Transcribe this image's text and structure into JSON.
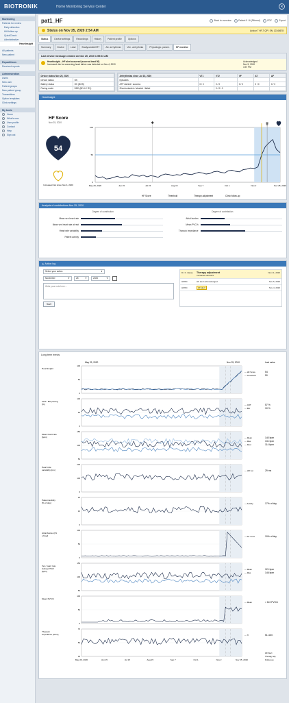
{
  "app": {
    "brand": "BIOTRONIK",
    "title": "Home Monitoring Service Center"
  },
  "sidebar": {
    "sections": [
      {
        "title": "Monitoring",
        "items": [
          {
            "label": "Patients for review",
            "sub": false
          },
          {
            "label": "Early detection",
            "sub": true
          },
          {
            "label": "HM follow-up",
            "sub": true
          },
          {
            "label": "QuickCheck",
            "sub": true
          },
          {
            "label": "Administrative",
            "sub": true
          },
          {
            "label": "Heartinsight",
            "sub": false,
            "active": true
          }
        ]
      },
      {
        "title": "",
        "items": [
          {
            "label": "All patients",
            "sub": false
          },
          {
            "label": "New patient",
            "sub": false
          }
        ]
      },
      {
        "title": "Repartitions",
        "items": [
          {
            "label": "Received reports",
            "sub": false
          }
        ]
      },
      {
        "title": "Administration",
        "items": [
          {
            "label": "Users",
            "sub": false
          },
          {
            "label": "New user",
            "sub": false
          },
          {
            "label": "Patient groups",
            "sub": false
          },
          {
            "label": "New patient group",
            "sub": false
          },
          {
            "label": "Transmitters",
            "sub": false
          },
          {
            "label": "Option templates",
            "sub": false
          },
          {
            "label": "Clinic settings",
            "sub": false
          }
        ]
      }
    ],
    "tools_title": "My tools",
    "tools": [
      "Home",
      "What's new",
      "User profile",
      "Contact",
      "Help",
      "Sign out"
    ]
  },
  "patient": {
    "name": "pat1_HF"
  },
  "header_actions": [
    "Back to overview",
    "Patient 5 / 6 (Filtered)",
    "PDF",
    "Export"
  ],
  "status": {
    "text": "Status on Nov 25, 2020 2:54 AM",
    "device": "Acticor 7 HF-T QP / SN: 12345678"
  },
  "tabs_main": [
    "Status",
    "Device settings",
    "Recordings",
    "History",
    "Patient profile",
    "Options"
  ],
  "tabs_sub": [
    "Summary",
    "Device",
    "Lead",
    "Bradycardia/CRT",
    "Atr. arrhythmia",
    "Ven. arrhythmia",
    "Physiologic. param.",
    "HF monitor"
  ],
  "last_message": {
    "title": "Last device message created on Nov 25, 2020 1:55:03 AM",
    "line1": "HeartInsight – HF alert occurred (score at least 50)",
    "line2": "Increased risk for worsening heart failure was detected on Nov 4, 2020",
    "ack": "Acknowledged",
    "ack_date": "Nov 5, 2020",
    "ack_time": "3:37 PM"
  },
  "device_status": {
    "title": "Device status Nov 25, 2020",
    "rows": [
      {
        "label": "Device status",
        "value": "OK"
      },
      {
        "label": "Battery status",
        "value": "OK (BOS)"
      },
      {
        "label": "Pacing mode",
        "value": "DDD (BiV LV RV)"
      }
    ]
  },
  "arrhythmia": {
    "title": "Arrhythmias since Jul 15, 2020",
    "cols": [
      "VT1",
      "VT2",
      "VF",
      "AT",
      "AF"
    ],
    "rows": [
      {
        "label": "Episodes",
        "values": [
          "",
          "",
          "",
          "",
          ""
        ]
      },
      {
        "label": "ATP started / success",
        "values": [
          "0 / 0",
          "0 / 0",
          "0 / 0",
          "0 / 0",
          "0 / 0"
        ]
      },
      {
        "label": "Shocks started / aborted / failed",
        "values": [
          "",
          "0 / 0 / 0",
          "",
          "",
          ""
        ]
      }
    ]
  },
  "heartinsight": {
    "title": "HeartInsight",
    "score_title": "HF Score",
    "score_date": "Nov 25, 2020",
    "score": "54",
    "risk_text": "Increased risk since Nov 4, 2020",
    "chart_data": {
      "type": "line",
      "x_labels": [
        "May 29, 2020",
        "Jun 15",
        "Jul 15",
        "Aug 15",
        "Sep 7",
        "Oct 1",
        "Nov 2",
        "Nov 25, 2020"
      ],
      "y_ticks": [
        100,
        50,
        0
      ],
      "threshold": 50,
      "series": [
        {
          "name": "HF Score",
          "values": [
            12,
            8,
            10,
            6,
            7,
            9,
            11,
            8,
            10,
            9,
            14,
            12,
            11,
            13,
            10,
            12,
            11,
            9,
            13,
            15,
            14,
            12,
            14,
            13,
            16,
            15,
            14,
            16,
            18,
            17,
            15,
            16,
            19,
            20,
            18,
            17,
            21,
            22,
            20,
            19,
            23,
            24,
            26,
            25,
            28,
            50,
            65,
            72,
            78,
            60,
            54
          ]
        }
      ],
      "legend": [
        "HF Score",
        "Threshold",
        "Therapy adjustment",
        "Clinic follow-up"
      ]
    }
  },
  "contributions": {
    "title": "Analysis of contributions Nov 25, 2020",
    "col_head": "Degree of contribution",
    "left": [
      {
        "label": "Mean ven heart rate",
        "value": 0.42
      },
      {
        "label": "Mean ven heart rate at rest",
        "value": 0.5
      },
      {
        "label": "Heart rate variability",
        "value": 0.26
      },
      {
        "label": "Patient activity",
        "value": 0.18
      }
    ],
    "right": [
      {
        "label": "Atrial burden",
        "value": 0.3
      },
      {
        "label": "Mean PVC/h",
        "value": 0.36
      },
      {
        "label": "Thoracic impedance",
        "value": 0.55
      },
      {
        "label": "",
        "value": 0
      }
    ]
  },
  "action_log": {
    "title": "Action log",
    "select_action": "Select your action",
    "month": "November",
    "day": "25",
    "year": "2020",
    "note_placeholder": "Write your note here...",
    "save": "Save",
    "entries": [
      {
        "who": "Dr. K. Hasse",
        "what": "Therapy adjustment",
        "detail": "Increased diuretics",
        "date": "Nov 11, 2020",
        "highlight": true
      },
      {
        "who": "HMSC",
        "what": "HF alert acknowledged",
        "detail": "",
        "date": "Nov 5, 2020",
        "highlight": false
      },
      {
        "who": "HMSC",
        "what": "HF alert",
        "detail": "",
        "date": "Nov 4, 2020",
        "highlight": false
      }
    ]
  },
  "trends": {
    "title": "Long term trends",
    "date_start": "May 29, 2020",
    "date_end": "Nov 25, 2020",
    "last_value_head": "Last value",
    "x_labels": [
      "May 29, 2020",
      "Jun 15",
      "Jul 15",
      "Aug 15",
      "Sep 7",
      "Oct 1",
      "Nov 2",
      "Nov 25, 2020"
    ],
    "footer_legend": [
      "HF Alert",
      "Therapy adj.",
      "Follow-up"
    ],
    "panels": [
      {
        "label": "HeartInsight",
        "ymax": "100",
        "ymid": "50",
        "ymin": "0",
        "legend": [
          "HF Score",
          "Threshold"
        ],
        "last": [
          "54",
          "50"
        ]
      },
      {
        "label": "CRT / BiV pacing [%]",
        "ymax": "100",
        "ymid": "50",
        "ymin": "0",
        "legend": [
          "CRT",
          "BiV"
        ],
        "last": [
          "57 %",
          "10 %"
        ]
      },
      {
        "label": "Mean heart rate [bpm]",
        "ymax": "150",
        "ymid": "100",
        "ymin": "50",
        "legend": [
          "Mean",
          "Max.",
          "Rest"
        ],
        "last": [
          "140 bpm",
          "131 bpm",
          "114 bpm"
        ]
      },
      {
        "label": "Heart rate variability [ms]",
        "ymax": "200",
        "ymid": "100",
        "ymin": "0",
        "legend": [
          "HR var."
        ],
        "last": [
          "29 ms"
        ]
      },
      {
        "label": "Patient activity [% of day]",
        "ymax": "20",
        "ymid": "10",
        "ymin": "0",
        "legend": [
          "Activity"
        ],
        "last": [
          "17% of day"
        ]
      },
      {
        "label": "Atrial burden [% of day]",
        "ymax": "100",
        "ymid": "50",
        "ymin": "0",
        "legend": [
          "Atr. burd."
        ],
        "last": [
          "10% of day"
        ]
      },
      {
        "label": "Ven. heart rate during AT/AF [bpm]",
        "ymax": "150",
        "ymid": "100",
        "ymin": "50",
        "legend": [
          "Mean",
          "Max."
        ],
        "last": [
          "121 bpm",
          "146 bpm"
        ]
      },
      {
        "label": "Mean PVC/h",
        "ymax": "100",
        "ymid": "50",
        "ymin": "0",
        "legend": [
          "Mean"
        ],
        "last": [
          "> 110 PVC/h"
        ]
      },
      {
        "label": "Thoracic impedance [Ohm]",
        "ymax": "70",
        "ymid": "50",
        "ymin": "30",
        "legend": [
          "TI"
        ],
        "last": [
          "51 ohm"
        ]
      }
    ]
  },
  "colors": {
    "navy": "#1d2c4a",
    "blue": "#3a78b8",
    "light_blue": "#8fb7df",
    "yellow": "#f0c400",
    "threshold": "#5aa0dc"
  }
}
